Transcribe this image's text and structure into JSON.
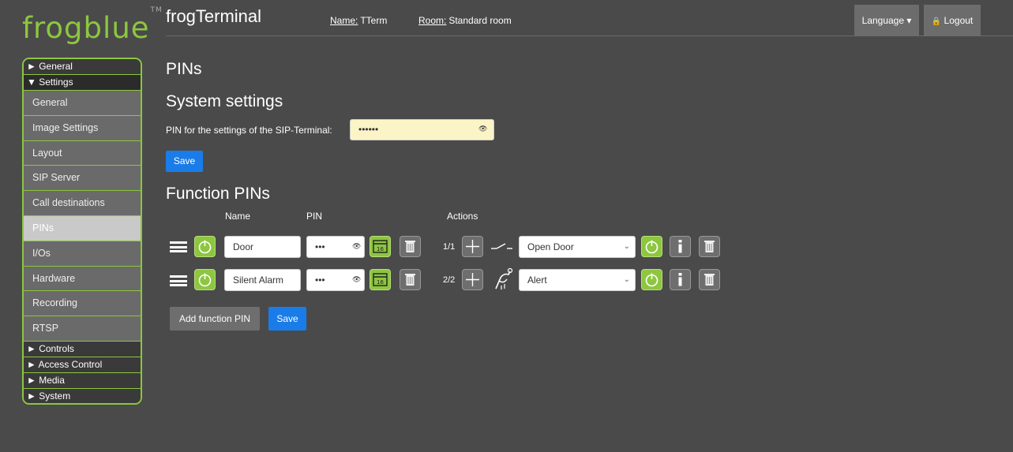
{
  "logo": {
    "text": "frogblue",
    "tm": "TM"
  },
  "sidebar": {
    "general_head": "► General",
    "settings_head": "▼ Settings",
    "items": [
      "General",
      "Image Settings",
      "Layout",
      "SIP Server",
      "Call destinations",
      "PINs",
      "I/Os",
      "Hardware",
      "Recording",
      "RTSP"
    ],
    "footer": [
      "► Controls",
      "► Access Control",
      "► Media",
      "► System"
    ]
  },
  "header": {
    "title": "frogTerminal",
    "name_label": "Name:",
    "name_value": "TTerm",
    "room_label": "Room:",
    "room_value": "Standard room",
    "language": "Language ▾",
    "logout": "Logout"
  },
  "page": {
    "title": "PINs",
    "system_title": "System settings",
    "pin_label": "PIN for the settings of the SIP-Terminal:",
    "pin_value": "••••••",
    "save": "Save",
    "function_title": "Function PINs",
    "col_name": "Name",
    "col_pin": "PIN",
    "col_actions": "Actions",
    "add_label": "Add function PIN",
    "save2": "Save"
  },
  "rows": [
    {
      "name": "Door",
      "pin": "•••",
      "count": "1/1",
      "action": "Open Door"
    },
    {
      "name": "Silent Alarm",
      "pin": "•••",
      "count": "2/2",
      "action": "Alert"
    }
  ],
  "colors": {
    "brand": "#8dc63f",
    "accent": "#1a7ce8",
    "bg": "#4a4a4a"
  }
}
